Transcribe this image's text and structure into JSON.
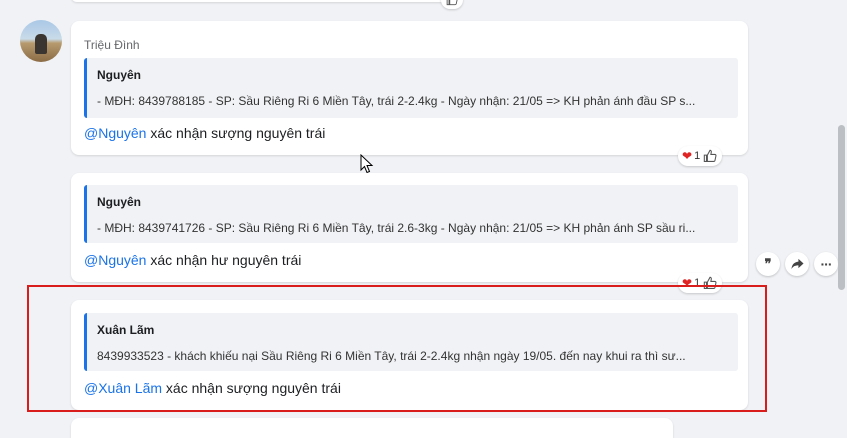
{
  "messages": [
    {
      "sender": "Triệu Đình",
      "quote_name": "Nguyên",
      "quote_text": "- MĐH: 8439788185 - SP: Sầu Riêng Ri 6 Miền Tây, trái 2-2.4kg - Ngày nhận: 21/05 => KH phản ánh đầu SP s...",
      "mention": "@Nguyên",
      "text": " xác nhận sượng nguyên trái",
      "reaction_count": "1"
    },
    {
      "quote_name": "Nguyên",
      "quote_text": "- MĐH: 8439741726 - SP: Sầu Riêng Ri 6 Miền Tây, trái 2.6-3kg - Ngày nhận: 21/05 => KH phản ánh SP sầu ri...",
      "mention": "@Nguyên",
      "text": " xác nhận hư nguyên trái",
      "reaction_count": "1"
    },
    {
      "quote_name": "Xuân Lãm",
      "quote_text": "8439933523 - khách khiếu nại Sầu Riêng Ri 6 Miền Tây, trái 2-2.4kg nhận ngày 19/05. đến nay khui ra thì sư...",
      "mention": "@Xuân Lãm",
      "text": " xác nhận sượng nguyên trái"
    }
  ],
  "icons": {
    "reply": "quote-reply-icon",
    "forward": "forward-icon",
    "more": "more-icon",
    "heart": "heart-icon",
    "like": "thumbs-up-icon"
  },
  "colors": {
    "mention": "#1a73e8",
    "highlight_border": "#d91c1c",
    "heart": "#e02424"
  }
}
